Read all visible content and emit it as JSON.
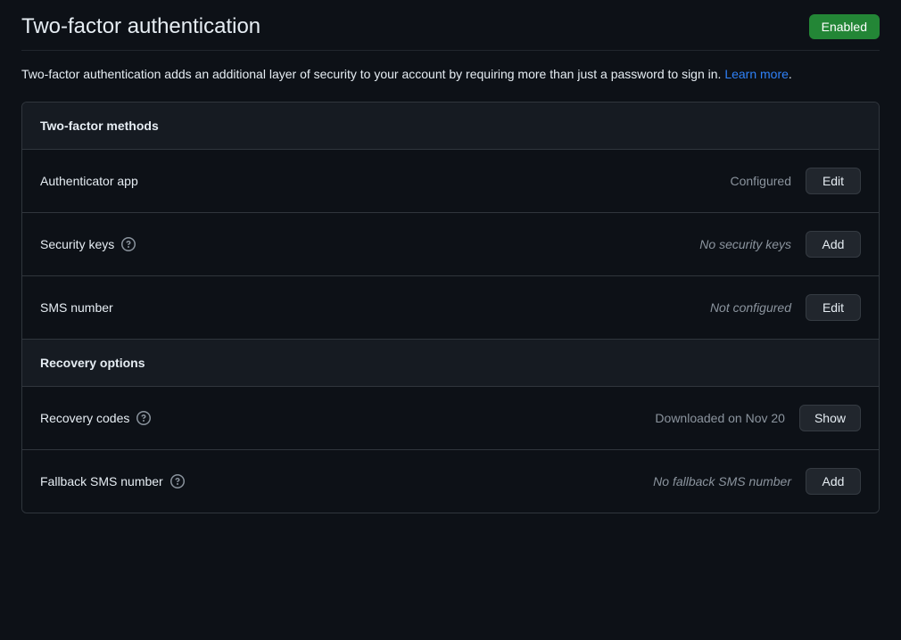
{
  "header": {
    "title": "Two-factor authentication",
    "badge": "Enabled"
  },
  "description": {
    "text_before": "Two-factor authentication adds an additional layer of security to your account by requiring more than just a password to sign in. ",
    "link_text": "Learn more",
    "text_after": "."
  },
  "methods": {
    "heading": "Two-factor methods",
    "items": [
      {
        "label": "Authenticator app",
        "has_info": false,
        "status": "Configured",
        "status_italic": false,
        "button": "Edit"
      },
      {
        "label": "Security keys",
        "has_info": true,
        "status": "No security keys",
        "status_italic": true,
        "button": "Add"
      },
      {
        "label": "SMS number",
        "has_info": false,
        "status": "Not configured",
        "status_italic": true,
        "button": "Edit"
      }
    ]
  },
  "recovery": {
    "heading": "Recovery options",
    "items": [
      {
        "label": "Recovery codes",
        "has_info": true,
        "status": "Downloaded on Nov 20",
        "status_italic": false,
        "button": "Show"
      },
      {
        "label": "Fallback SMS number",
        "has_info": true,
        "status": "No fallback SMS number",
        "status_italic": true,
        "button": "Add"
      }
    ]
  }
}
